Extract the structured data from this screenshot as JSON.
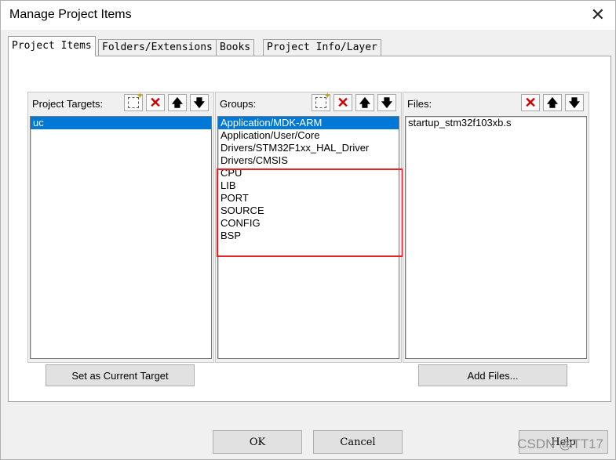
{
  "window": {
    "title": "Manage Project Items",
    "close_glyph": "✕"
  },
  "tabs": [
    {
      "label": "Project Items",
      "active": true
    },
    {
      "label": "Folders/Extensions",
      "active": false
    },
    {
      "label": "Books",
      "active": false
    },
    {
      "label": "Project Info/Layer",
      "active": false
    }
  ],
  "targets": {
    "label": "Project Targets:",
    "items": [
      "uc"
    ],
    "selected": "uc",
    "button": "Set as Current Target"
  },
  "groups": {
    "label": "Groups:",
    "items": [
      "Application/MDK-ARM",
      "Application/User/Core",
      "Drivers/STM32F1xx_HAL_Driver",
      "Drivers/CMSIS",
      "CPU",
      "LIB",
      "PORT",
      "SOURCE",
      "CONFIG",
      "BSP"
    ],
    "selected": "Application/MDK-ARM"
  },
  "files": {
    "label": "Files:",
    "items": [
      "startup_stm32f103xb.s"
    ],
    "button": "Add Files..."
  },
  "toolbar_icons": [
    "new-icon",
    "delete-icon",
    "move-up-icon",
    "move-down-icon"
  ],
  "footer": {
    "ok": "OK",
    "cancel": "Cancel",
    "help": "Help"
  },
  "watermark": "CSDN @TT17",
  "colors": {
    "selection": "#0078d7",
    "highlight": "#e0262b",
    "delete": "#d00000"
  }
}
